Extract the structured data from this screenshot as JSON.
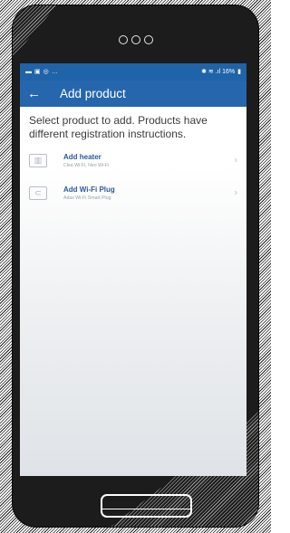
{
  "statusbar": {
    "left_icons": [
      "▬",
      "▣",
      "◎",
      "…"
    ],
    "right_text": "✱ ≋ .ıl 16%",
    "battery_icon": "▮"
  },
  "appbar": {
    "back_icon": "←",
    "title": "Add product"
  },
  "intro": "Select product to add. Products have different registration instructions.",
  "items": [
    {
      "title": "Add heater",
      "subtitle": "Clea Wi-Fi, Neo Wi-Fi",
      "icon": "heater-icon",
      "icon_glyph": "▥",
      "chevron": "›"
    },
    {
      "title": "Add Wi-Fi Plug",
      "subtitle": "Adax Wi-Fi Smart Plug",
      "icon": "plug-icon",
      "icon_glyph": "⊂",
      "chevron": "›"
    }
  ],
  "colors": {
    "statusbar": "#1f63a8",
    "appbar": "#2666ad",
    "item_title": "#2a5a99"
  }
}
